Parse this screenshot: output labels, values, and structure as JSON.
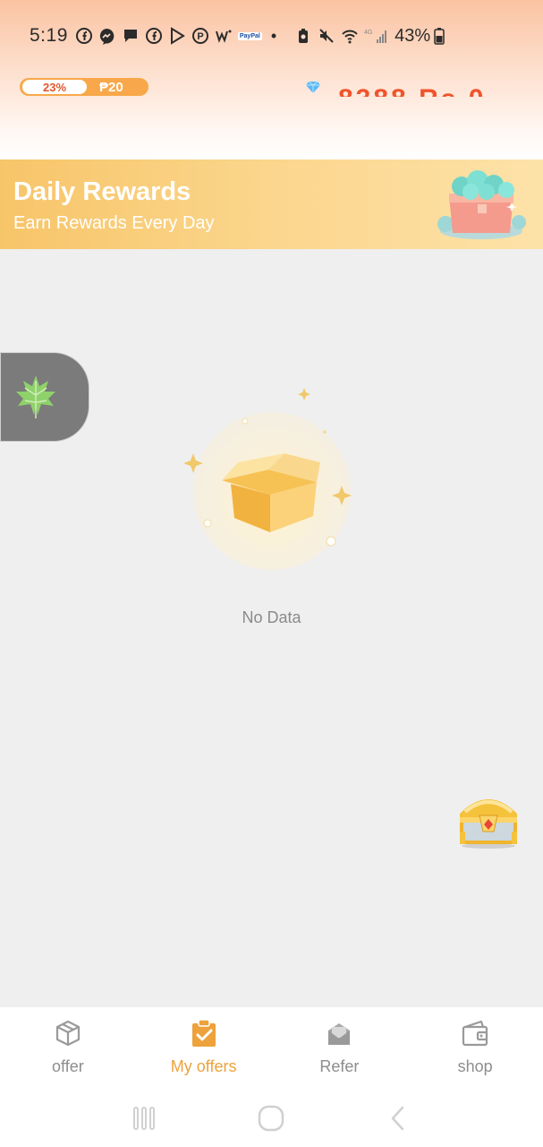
{
  "status_bar": {
    "time": "5:19",
    "battery": "43%",
    "paypal_label": "PayPal",
    "dot": "•"
  },
  "header": {
    "progress_percent": "23%",
    "progress_fraction": 0.23,
    "reward_amount": "₱20",
    "balance_partial": "8388 Rs 0"
  },
  "banner": {
    "title": "Daily Rewards",
    "subtitle": "Earn Rewards Every Day"
  },
  "empty_state": {
    "message": "No Data"
  },
  "bottom_nav": {
    "items": [
      {
        "label": "offer",
        "icon": "box-icon",
        "active": false
      },
      {
        "label": "My offers",
        "icon": "clipboard-check-icon",
        "active": true
      },
      {
        "label": "Refer",
        "icon": "envelope-icon",
        "active": false
      },
      {
        "label": "shop",
        "icon": "wallet-icon",
        "active": false
      }
    ]
  },
  "colors": {
    "accent_orange": "#eda23b",
    "balance_red": "#f0542c",
    "banner_start": "#f7c569",
    "banner_end": "#fde2a8",
    "inactive_gray": "#8d8d8d"
  }
}
